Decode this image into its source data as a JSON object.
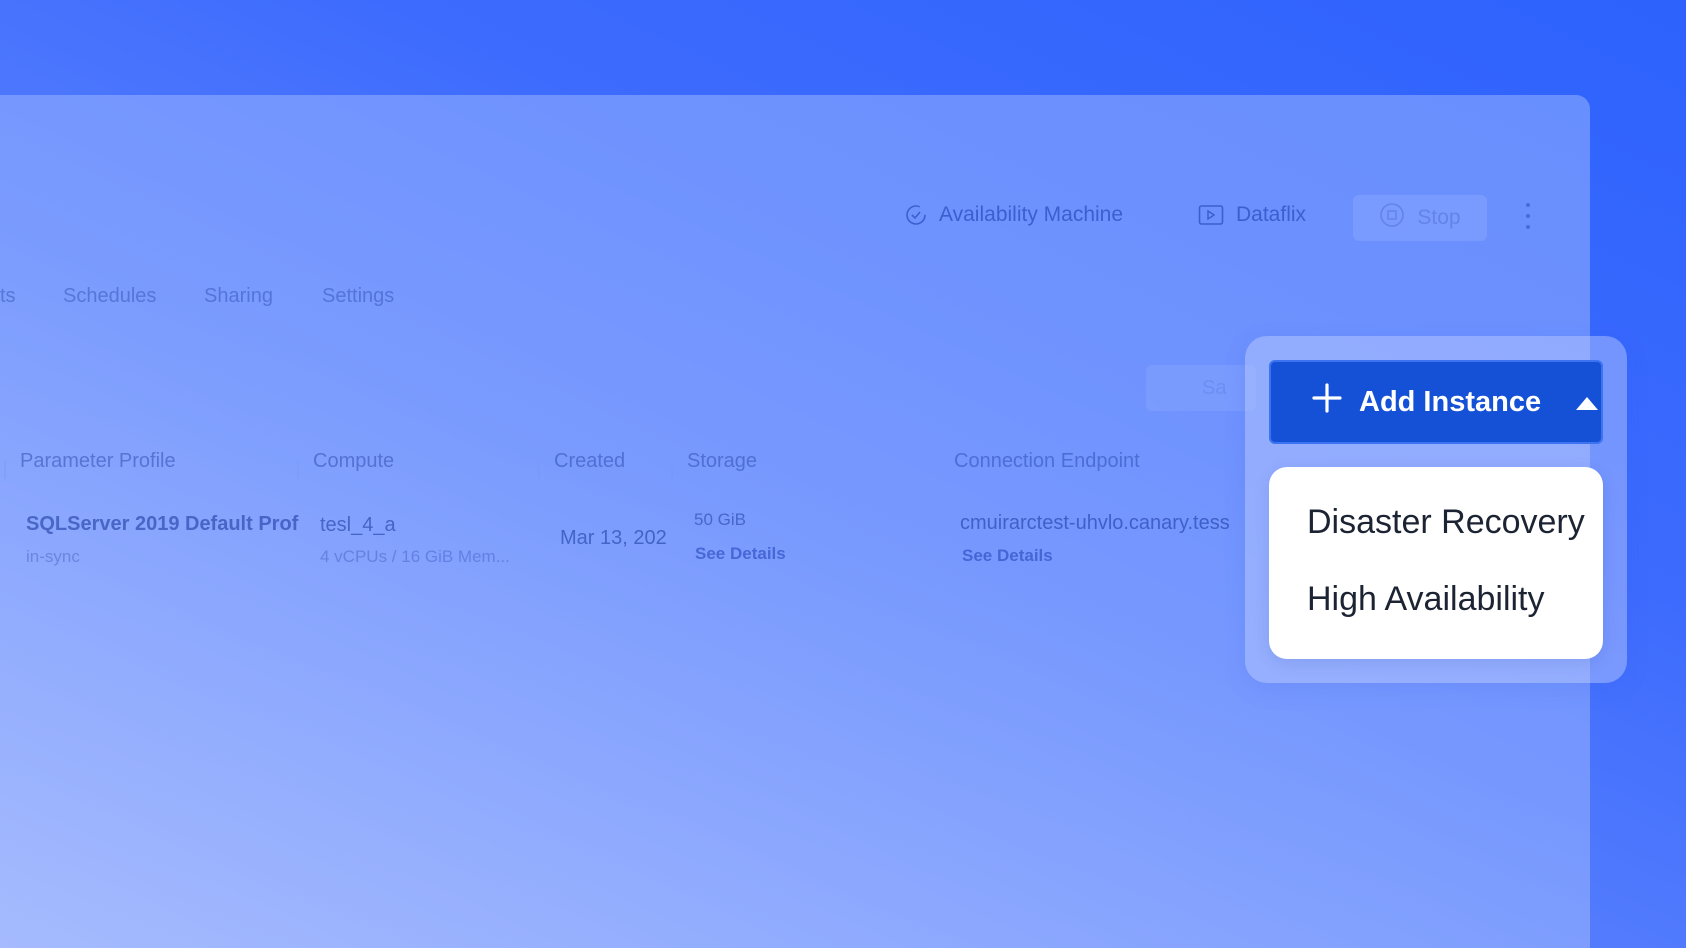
{
  "toolbar": {
    "availability_machine_label": "Availability Machine",
    "dataflix_label": "Dataflix",
    "stop_label": "Stop"
  },
  "tabs": [
    {
      "label": "ts"
    },
    {
      "label": "Schedules"
    },
    {
      "label": "Sharing"
    },
    {
      "label": "Settings"
    }
  ],
  "ghost_button_label": "Sa",
  "table": {
    "columns": [
      "Parameter Profile",
      "Compute",
      "Created",
      "Storage",
      "Connection Endpoint"
    ],
    "row": {
      "parameter_profile": "SQLServer 2019 Default Prof",
      "status": "in-sync",
      "compute_name": "tesl_4_a",
      "compute_specs": "4 vCPUs / 16 GiB Mem...",
      "created": "Mar 13, 202",
      "storage": "50 GiB",
      "storage_link": "See Details",
      "endpoint": "cmuirarctest-uhvlo.canary.tess",
      "endpoint_link": "See Details"
    }
  },
  "add_instance": {
    "label": "Add Instance",
    "menu": [
      "Disaster Recovery",
      "High Availability"
    ]
  },
  "colors": {
    "primary_button": "#1551d6",
    "background_accent": "#2d62fd"
  }
}
